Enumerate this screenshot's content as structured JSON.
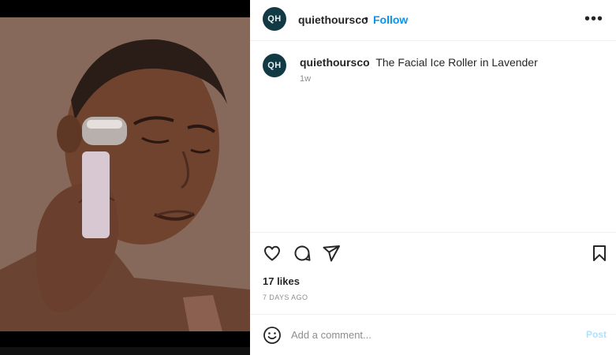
{
  "post": {
    "image_description": "person using facial ice roller",
    "account": {
      "avatar_initials": "QH",
      "username": "quiethoursco",
      "separator": "•",
      "follow_label": "Follow",
      "more_label": "•••"
    },
    "caption": {
      "username": "quiethoursco",
      "text": "The Facial Ice Roller in Lavender",
      "time_ago": "1w"
    },
    "actions": {
      "likes": "17 likes",
      "date": "7 DAYS AGO"
    },
    "comment_box": {
      "placeholder": "Add a comment...",
      "post_label": "Post"
    }
  },
  "colors": {
    "avatar_bg": "#123a45",
    "link_blue": "#0095f6",
    "post_disabled": "#b2dffc",
    "muted": "#8e8e8e"
  },
  "icons": {
    "like": "heart-icon",
    "comment": "comment-icon",
    "share": "send-icon",
    "save": "bookmark-icon",
    "emoji": "smile-icon"
  }
}
